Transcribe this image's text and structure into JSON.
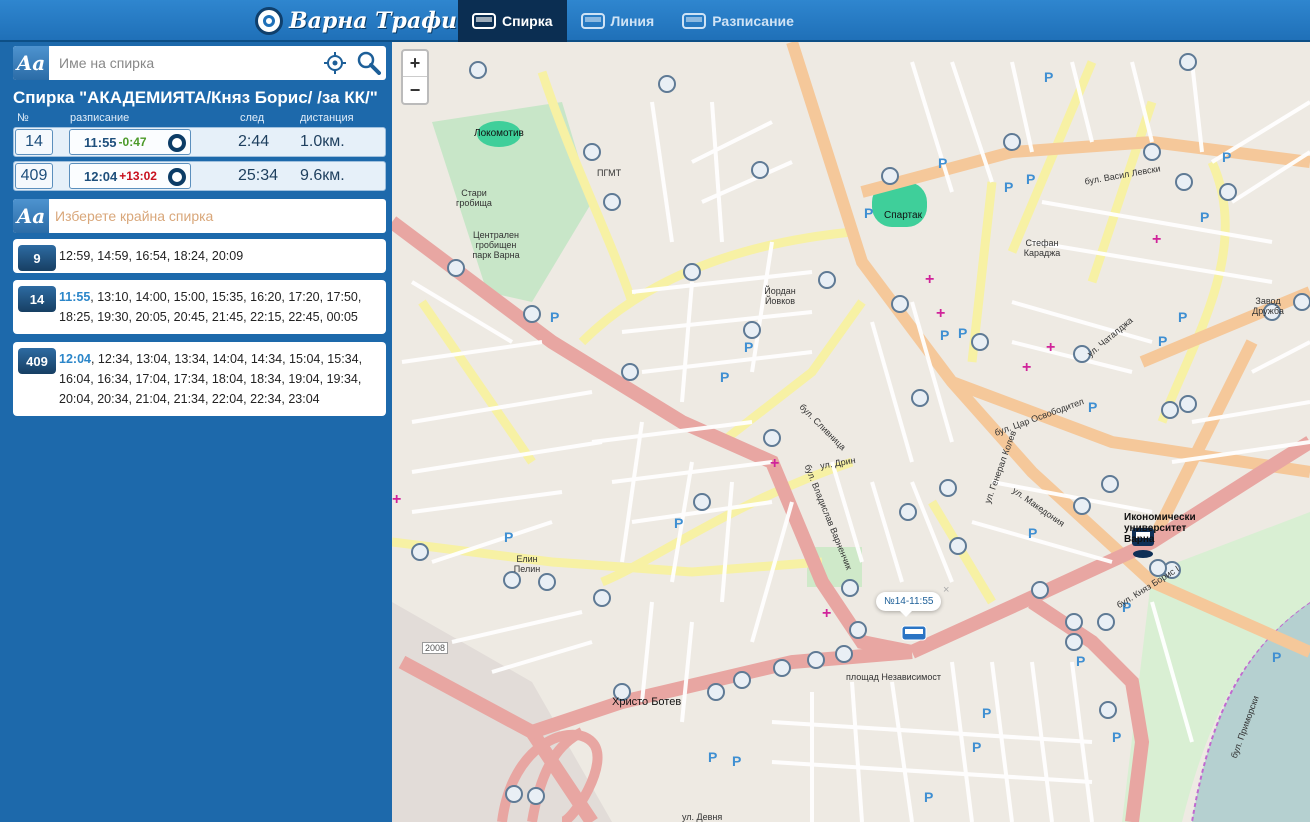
{
  "app": {
    "logo_text": "Варна Трафик"
  },
  "nav": {
    "tabs": [
      {
        "label": "Спирка",
        "active": true
      },
      {
        "label": "Линия",
        "active": false
      },
      {
        "label": "Разписание",
        "active": false
      }
    ]
  },
  "search": {
    "aa_label": "Aa",
    "placeholder": "Име на спирка"
  },
  "stop": {
    "title": "Спирка \"АКАДЕМИЯТА/Княз Борис/ /за КК/\""
  },
  "arrivals": {
    "headers": {
      "num": "№",
      "schedule": "разписание",
      "after": "след",
      "distance": "дистанция"
    },
    "rows": [
      {
        "line": "14",
        "time": "11:55",
        "delta": "-0:47",
        "after": "2:44",
        "distance": "1.0км."
      },
      {
        "line": "409",
        "time": "12:04",
        "delta": "+13:02",
        "after": "25:34",
        "distance": "9.6км."
      }
    ]
  },
  "end_stop": {
    "aa_label": "Aa",
    "placeholder": "Изберете крайна спирка"
  },
  "schedules": [
    {
      "line": "9",
      "highlight": "",
      "times": "12:59, 14:59, 16:54, 18:24, 20:09"
    },
    {
      "line": "14",
      "highlight": "11:55",
      "times": ", 13:10, 14:00, 15:00, 15:35, 16:20, 17:20, 17:50, 18:25, 19:30, 20:05, 20:45, 21:45, 22:15, 22:45, 00:05"
    },
    {
      "line": "409",
      "highlight": "12:04",
      "times": ", 12:34, 13:04, 13:34, 14:04, 14:34, 15:04, 15:34, 16:04, 16:34, 17:04, 17:34, 18:04, 18:34, 19:04, 19:34, 20:04, 20:34, 21:04, 21:34, 22:04, 22:34, 23:04"
    }
  ],
  "map": {
    "zoom_in": "+",
    "zoom_out": "−",
    "popup_text": "№14-11:55",
    "popup_close": "×",
    "labels": [
      "бул. Владислав Варненчик",
      "бул. Цар Освободител",
      "бул. Сливница",
      "бул. Княз Борис I",
      "бул. Приморски",
      "бул. Васил Левски",
      "Христо Ботев",
      "ул. Девня",
      "Локомотив",
      "Спартак",
      "Икономически университет Варна",
      "Централен гробищен парк Варна",
      "Стари гробища",
      "ПГМТ",
      "площад Независимост",
      "Стефан Караджа",
      "Йордан Йовков",
      "Елин Пелин",
      "Завод Дружба",
      "бул. Вл. Варненчик",
      "ул. Дрин",
      "ул. Генерал Колев",
      "ул. Македония",
      "ул. Чаталджа",
      "2008"
    ]
  },
  "colors": {
    "topbar": "#2f86cf",
    "sidebar": "#1d69ab",
    "active_tab": "#0b2e52",
    "delay_positive": "#4c9a2a",
    "delay_negative": "#c8101e",
    "highlight_time": "#2b86c9",
    "primary_road": "#e8a6a2",
    "secondary_road": "#f5c89a",
    "tertiary_road": "#f7f1a4",
    "sea": "#b5d0d0",
    "park": "#c8e6c8"
  }
}
